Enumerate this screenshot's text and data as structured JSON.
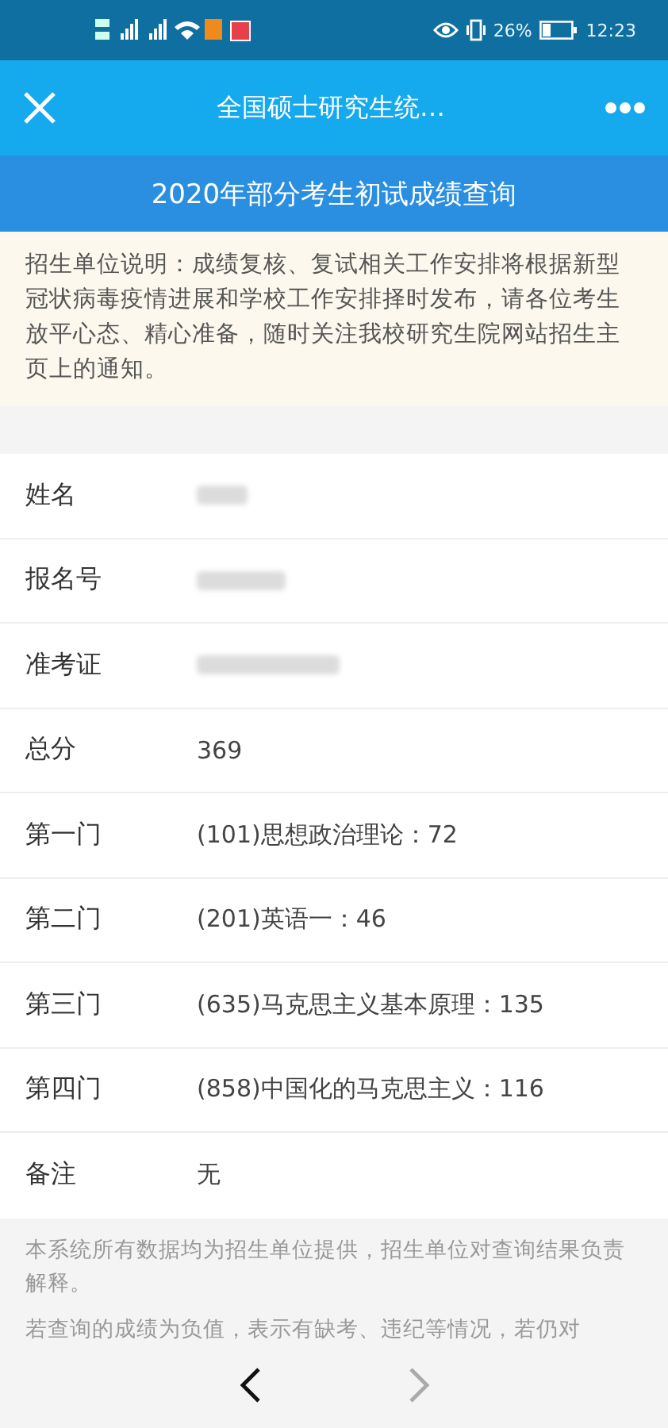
{
  "status_bar": {
    "battery": "26%",
    "time": "12:23"
  },
  "nav_bar": {
    "title": "全国硕士研究生统…"
  },
  "banner": {
    "title": "2020年部分考生初试成绩查询"
  },
  "notice": "招生单位说明：成绩复核、复试相关工作安排将根据新型冠状病毒疫情进展和学校工作安排择时发布，请各位考生放平心态、精心准备，随时关注我校研究生院网站招生主页上的通知。",
  "rows": [
    {
      "label": "姓名",
      "kind": "redacted"
    },
    {
      "label": "报名号",
      "kind": "redacted"
    },
    {
      "label": "准考证",
      "kind": "redacted"
    },
    {
      "label": "总分",
      "kind": "text",
      "value": "369"
    },
    {
      "label": "第一门",
      "kind": "text",
      "value": "(101)思想政治理论：72"
    },
    {
      "label": "第二门",
      "kind": "text",
      "value": "(201)英语一：46"
    },
    {
      "label": "第三门",
      "kind": "text",
      "value": "(635)马克思主义基本原理：135"
    },
    {
      "label": "第四门",
      "kind": "text",
      "value": "(858)中国化的马克思主义：116"
    },
    {
      "label": "备注",
      "kind": "text",
      "value": "无"
    }
  ],
  "footer_notes": [
    "本系统所有数据均为招生单位提供，招生单位对查询结果负责解释。",
    "若查询的成绩为负值，表示有缺考、违纪等情况，若仍对"
  ],
  "bottom_nav": {
    "back": {
      "disabled": false
    },
    "forward": {
      "disabled": true
    }
  }
}
